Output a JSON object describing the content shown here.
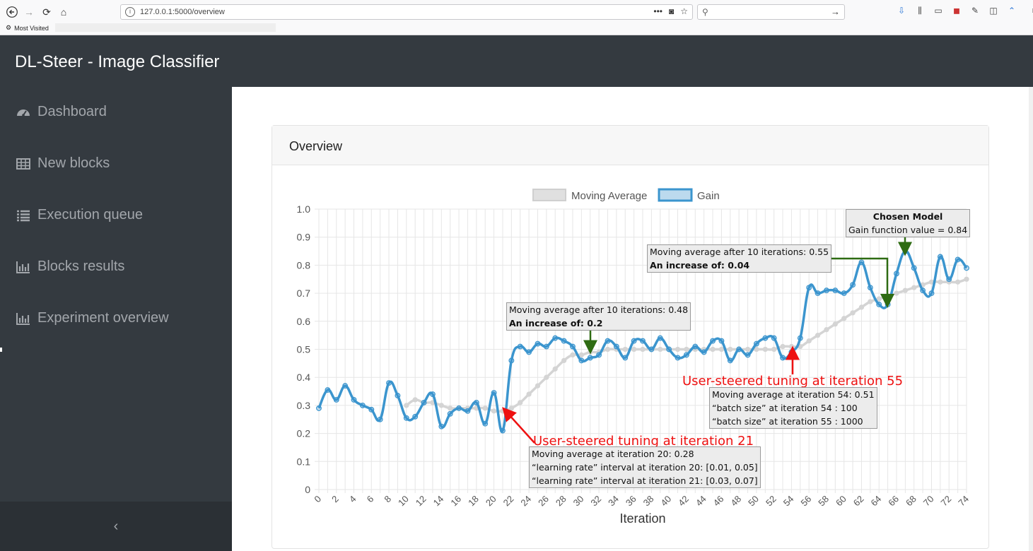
{
  "browser": {
    "url": "127.0.0.1:5000/overview",
    "bookmark_label": "Most Visited"
  },
  "app": {
    "title": "DL-Steer - Image Classifier"
  },
  "sidebar": {
    "items": [
      {
        "label": "Dashboard",
        "icon": "dashboard-icon"
      },
      {
        "label": "New blocks",
        "icon": "table-icon"
      },
      {
        "label": "Execution queue",
        "icon": "list-icon"
      },
      {
        "label": "Blocks results",
        "icon": "bar-chart-icon"
      },
      {
        "label": "Experiment overview",
        "icon": "bar-chart-icon"
      }
    ],
    "collapse_label": "‹"
  },
  "card": {
    "title": "Overview"
  },
  "annotations": {
    "a1_line1": "Moving average after 10 iterations: 0.48",
    "a1_line2": "An increase of: 0.2",
    "a2_line1": "Moving average after 10 iterations: 0.55",
    "a2_line2": "An increase of: 0.04",
    "a3_line1": "Chosen Model",
    "a3_line2": "Gain function value = 0.84",
    "red1": "User-steered tuning at iteration 21",
    "red2": "User-steered tuning at iteration 55",
    "b1_line1": "Moving average at iteration 20: 0.28",
    "b1_line2": "“learning rate” interval at iteration 20: [0.01, 0.05]",
    "b1_line3": "“learning rate” interval at iteration 21: [0.03, 0.07]",
    "b2_line1": "Moving average at iteration 54: 0.51",
    "b2_line2": "“batch size” at iteration 54 : 100",
    "b2_line3": "“batch size” at iteration 55 : 1000"
  },
  "chart_data": {
    "type": "line",
    "xlabel": "Iteration",
    "ylabel": "",
    "xlim": [
      0,
      74
    ],
    "ylim": [
      0,
      1.0
    ],
    "y_ticks": [
      "0",
      "0.1",
      "0.2",
      "0.3",
      "0.4",
      "0.5",
      "0.6",
      "0.7",
      "0.8",
      "0.9",
      "1.0"
    ],
    "x_ticks": [
      "0",
      "2",
      "4",
      "6",
      "8",
      "10",
      "12",
      "14",
      "16",
      "18",
      "20",
      "22",
      "24",
      "26",
      "28",
      "30",
      "32",
      "34",
      "36",
      "38",
      "40",
      "42",
      "44",
      "46",
      "48",
      "50",
      "52",
      "54",
      "56",
      "58",
      "60",
      "62",
      "64",
      "66",
      "68",
      "70",
      "72",
      "74"
    ],
    "legend_position": "top",
    "grid": true,
    "series": [
      {
        "name": "Moving Average",
        "color": "#d4d4d4",
        "values": [
          null,
          null,
          null,
          null,
          null,
          null,
          null,
          null,
          null,
          null,
          0.3,
          0.32,
          0.31,
          0.31,
          0.3,
          0.29,
          0.29,
          0.29,
          0.29,
          0.29,
          0.28,
          0.28,
          0.29,
          0.31,
          0.34,
          0.37,
          0.4,
          0.43,
          0.46,
          0.48,
          0.48,
          0.49,
          0.49,
          0.5,
          0.5,
          0.5,
          0.5,
          0.5,
          0.5,
          0.5,
          0.5,
          0.5,
          0.5,
          0.5,
          0.5,
          0.5,
          0.5,
          0.5,
          0.5,
          0.5,
          0.5,
          0.5,
          0.5,
          0.51,
          0.51,
          0.51,
          0.53,
          0.55,
          0.57,
          0.59,
          0.61,
          0.63,
          0.65,
          0.67,
          0.68,
          0.69,
          0.7,
          0.71,
          0.72,
          0.73,
          0.74,
          0.74,
          0.74,
          0.74,
          0.75
        ]
      },
      {
        "name": "Gain",
        "color": "#3b95ce",
        "values": [
          0.29,
          0.355,
          0.32,
          0.37,
          0.32,
          0.3,
          0.285,
          0.25,
          0.38,
          0.335,
          0.255,
          0.26,
          0.31,
          0.34,
          0.225,
          0.27,
          0.29,
          0.28,
          0.31,
          0.235,
          0.345,
          0.21,
          0.46,
          0.51,
          0.49,
          0.52,
          0.51,
          0.54,
          0.53,
          0.51,
          0.46,
          0.47,
          0.48,
          0.53,
          0.51,
          0.47,
          0.53,
          0.53,
          0.5,
          0.54,
          0.5,
          0.47,
          0.48,
          0.51,
          0.49,
          0.53,
          0.53,
          0.46,
          0.5,
          0.48,
          0.52,
          0.54,
          0.54,
          0.47,
          0.49,
          0.54,
          0.72,
          0.7,
          0.71,
          0.71,
          0.7,
          0.73,
          0.81,
          0.72,
          0.66,
          0.66,
          0.77,
          0.85,
          0.79,
          0.71,
          0.7,
          0.83,
          0.75,
          0.82,
          0.79
        ]
      }
    ]
  }
}
